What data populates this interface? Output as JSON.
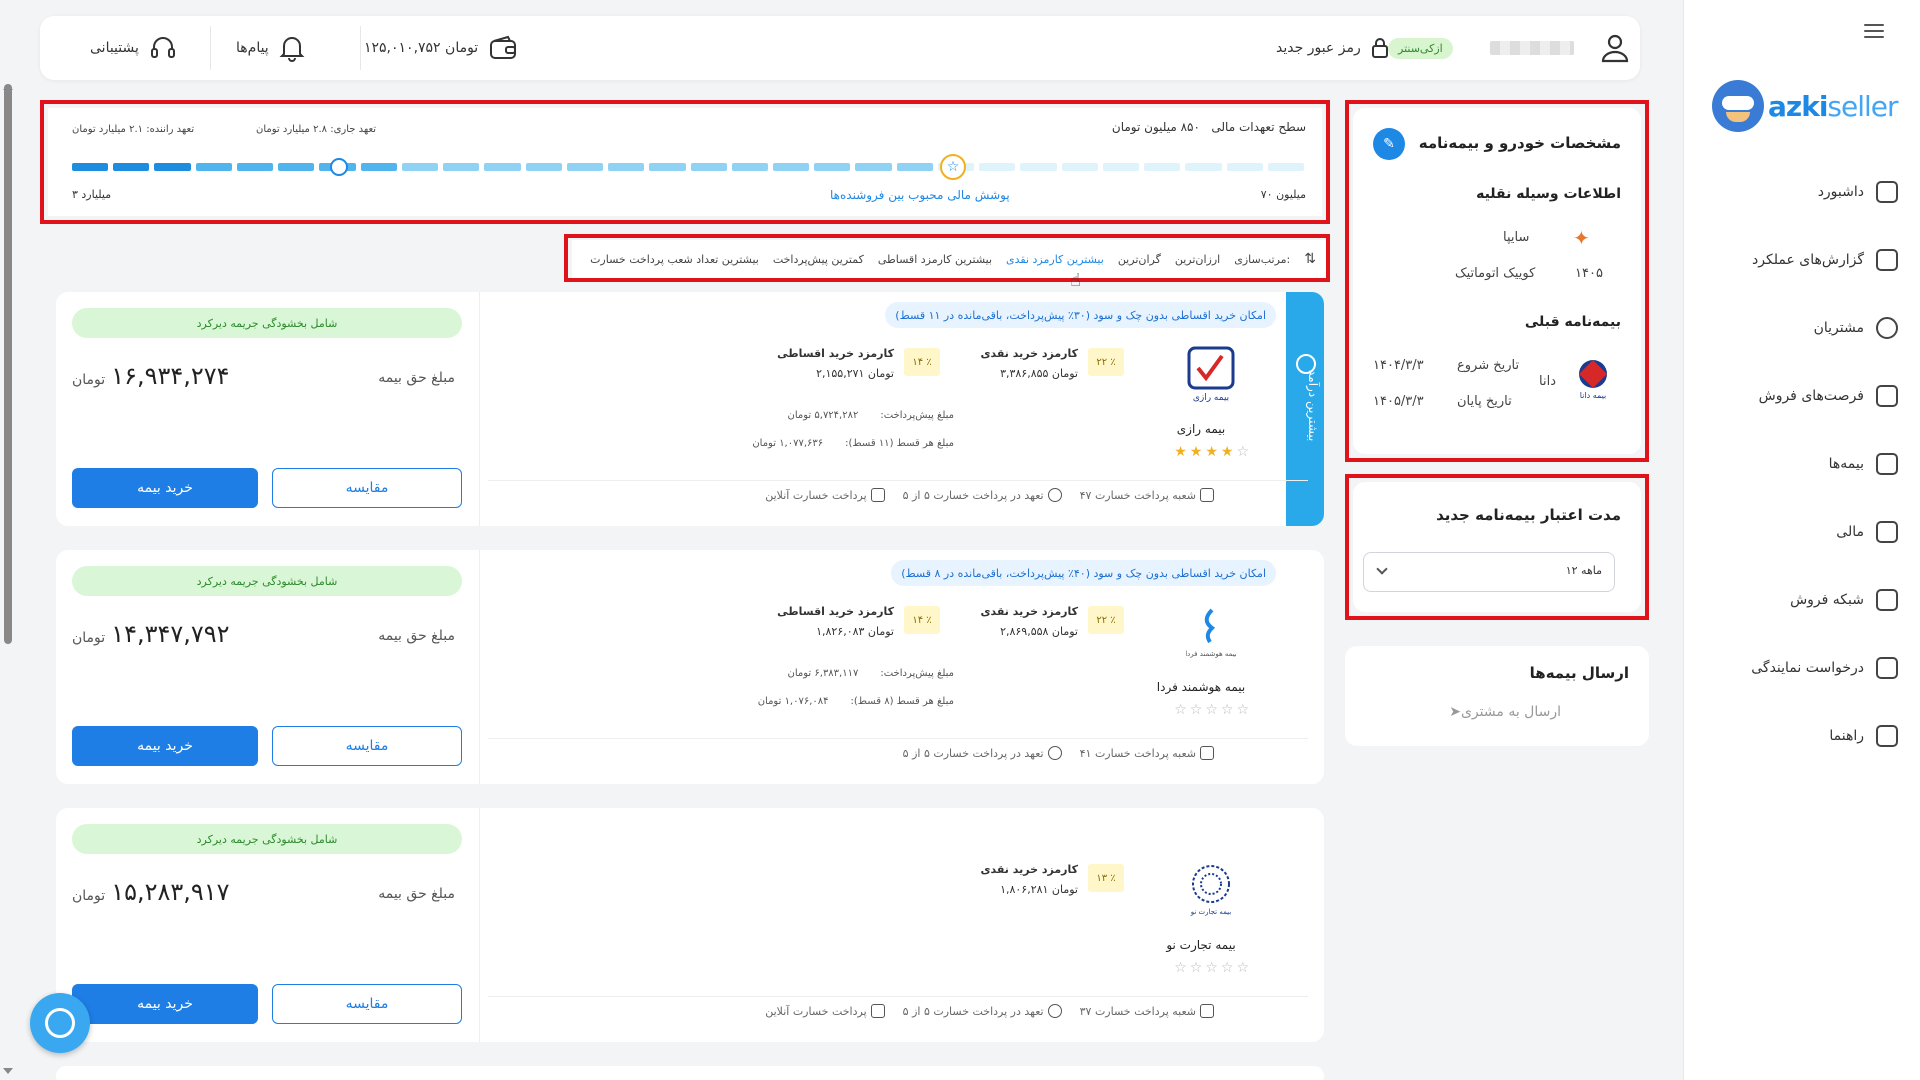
{
  "sidebar": {
    "brand_main": "azki",
    "brand_sub": "seller",
    "items": [
      {
        "label": "داشبورد",
        "icon": "dashboard-icon"
      },
      {
        "label": "گزارش‌های عملکرد",
        "icon": "chart-icon"
      },
      {
        "label": "مشتریان",
        "icon": "users-icon"
      },
      {
        "label": "فرصت‌های فروش",
        "icon": "document-icon"
      },
      {
        "label": "بیمه‌ها",
        "icon": "policy-icon"
      },
      {
        "label": "مالی",
        "icon": "wallet-icon"
      },
      {
        "label": "شبکه فروش",
        "icon": "network-icon"
      },
      {
        "label": "درخواست نمایندگی",
        "icon": "store-icon"
      },
      {
        "label": "راهنما",
        "icon": "help-icon"
      }
    ]
  },
  "topbar": {
    "support": "پشتیبانی",
    "messages": "پیام‌ها",
    "balance": "۱۲۵,۰۱۰,۷۵۲ تومان",
    "change_password": "رمز عبور جدید",
    "badge": "ازکی‌سنتر"
  },
  "finance": {
    "title": "سطح تعهدات مالی",
    "title_value": "۸۵۰ میلیون تومان",
    "current": "تعهد جاری: ۲.۸ میلیارد تومان",
    "driver": "تعهد راننده: ۲.۱ میلیارد تومان",
    "min_label": "۷۰ میلیون",
    "max_label": "۳ میلیارد",
    "popular": "پوشش مالی محبوب بین فروشنده‌ها"
  },
  "sort": {
    "label": "مرتب‌سازی:",
    "options": [
      "ارزان‌ترین",
      "گران‌ترین",
      "بیشترین کارمزد نقدی",
      "بیشترین کارمزد اقساطی",
      "کمترین پیش‌پرداخت",
      "بیشترین تعداد شعب پرداخت خسارت"
    ]
  },
  "cards": [
    {
      "pill": "شامل بخشودگی جریمه دیرکرد",
      "price_label": "مبلغ حق بیمه",
      "price": "۱۶,۹۳۴,۲۷۴",
      "unit": "تومان",
      "buy": "خرید بیمه",
      "compare": "مقایسه",
      "installment": "امکان خرید اقساطی بدون چک و سود (۳۰٪ پیش‌پرداخت، باقی‌مانده در ۱۱ قسط)",
      "insurer": "بیمه رازی",
      "cash_fee_title": "کارمزد خرید نقدی",
      "cash_fee": "۳,۳۸۶,۸۵۵ تومان",
      "cash_pct": "۲۲ ٪",
      "inst_fee_title": "کارمزد خرید اقساطی",
      "inst_fee": "۲,۱۵۵,۲۷۱ تومان",
      "inst_pct": "۱۴ ٪",
      "prepay_label": "مبلغ پیش‌پرداخت:",
      "prepay": "۵,۷۲۴,۲۸۲ تومان",
      "each_label": "مبلغ هر قسط (۱۱ قسط):",
      "each": "۱,۰۷۷,۶۳۶ تومان",
      "branches": "۴۷ شعبه پرداخت خسارت",
      "commit": "تعهد در پرداخت خسارت ۵ از ۵",
      "online": "پرداخت خسارت آنلاین",
      "ribbon": "بیشترین درآمد"
    },
    {
      "pill": "شامل بخشودگی جریمه دیرکرد",
      "price_label": "مبلغ حق بیمه",
      "price": "۱۴,۳۴۷,۷۹۲",
      "unit": "تومان",
      "buy": "خرید بیمه",
      "compare": "مقایسه",
      "installment": "امکان خرید اقساطی بدون چک و سود (۴۰٪ پیش‌پرداخت، باقی‌مانده در ۸ قسط)",
      "insurer": "بیمه هوشمند فردا",
      "cash_fee_title": "کارمزد خرید نقدی",
      "cash_fee": "۲,۸۶۹,۵۵۸ تومان",
      "cash_pct": "۲۲ ٪",
      "inst_fee_title": "کارمزد خرید اقساطی",
      "inst_fee": "۱,۸۲۶,۰۸۳ تومان",
      "inst_pct": "۱۴ ٪",
      "prepay_label": "مبلغ پیش‌پرداخت:",
      "prepay": "۶,۳۸۳,۱۱۷ تومان",
      "each_label": "مبلغ هر قسط (۸ قسط):",
      "each": "۱,۰۷۶,۰۸۴ تومان",
      "branches": "۴۱ شعبه پرداخت خسارت",
      "commit": "تعهد در پرداخت خسارت ۵ از ۵"
    },
    {
      "pill": "شامل بخشودگی جریمه دیرکرد",
      "price_label": "مبلغ حق بیمه",
      "price": "۱۵,۲۸۳,۹۱۷",
      "unit": "تومان",
      "buy": "خرید بیمه",
      "compare": "مقایسه",
      "insurer": "بیمه تجارت نو",
      "cash_fee_title": "کارمزد خرید نقدی",
      "cash_fee": "۱,۸۰۶,۲۸۱ تومان",
      "cash_pct": "۱۳ ٪",
      "branches": "۳۷ شعبه پرداخت خسارت",
      "commit": "تعهد در پرداخت خسارت ۵ از ۵",
      "online": "پرداخت خسارت آنلاین"
    }
  ],
  "car_panel": {
    "title": "مشخصات خودرو و بیمه‌نامه",
    "vehicle_title": "اطلاعات وسیله نقلیه",
    "brand": "سایپا",
    "model": "کوییک اتوماتیک",
    "year": "۱۴۰۵",
    "prev_title": "بیمه‌نامه قبلی",
    "prev_insurer": "دانا",
    "start_label": "تاریخ شروع",
    "start": "۱۴۰۴/۳/۳",
    "end_label": "تاریخ پایان",
    "end": "۱۴۰۵/۳/۳"
  },
  "validity_panel": {
    "title": "مدت اعتبار بیمه‌نامه جدید",
    "value": "۱۲ ماهه"
  },
  "send_panel": {
    "title": "ارسال بیمه‌ها",
    "action": "ارسال به مشتری"
  },
  "colors": {
    "primary": "#1e7ee6",
    "highlight": "#e0121a",
    "green_bg": "#d9f7d6",
    "ribbon": "#2aa9ea"
  }
}
